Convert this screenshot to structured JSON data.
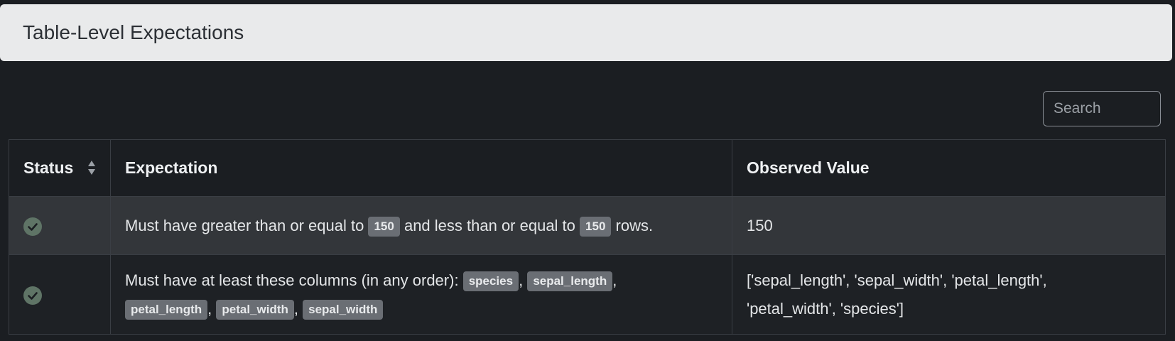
{
  "header": {
    "title": "Table-Level Expectations"
  },
  "search": {
    "placeholder": "Search"
  },
  "table": {
    "columns": {
      "status": "Status",
      "expectation": "Expectation",
      "observed": "Observed Value"
    },
    "rows": [
      {
        "status": "success",
        "expectation": {
          "prefix": "Must have greater than or equal to",
          "min": "150",
          "middle": "and less than or equal to",
          "max": "150",
          "suffix": "rows."
        },
        "observed": "150"
      },
      {
        "status": "success",
        "expectation": {
          "prefix": "Must have at least these columns (in any order):",
          "columns": [
            "species",
            "sepal_length",
            "petal_length",
            "petal_width",
            "sepal_width"
          ]
        },
        "observed_line1": "['sepal_length', 'sepal_width', 'petal_length',",
        "observed_line2": "'petal_width', 'species']"
      }
    ]
  },
  "colors": {
    "success_icon": "#5f7466",
    "header_bg": "#e9eaeb",
    "page_bg": "#1b1e22"
  }
}
